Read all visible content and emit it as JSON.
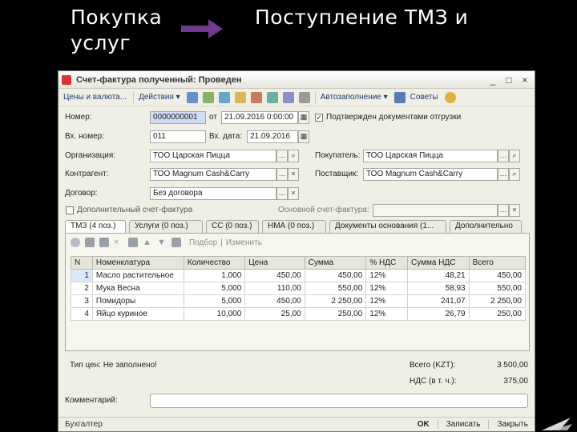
{
  "slide": {
    "left_title": "Покупка услуг",
    "right_title": "Поступление ТМЗ и"
  },
  "window": {
    "title": "Счет-фактура полученный: Проведен",
    "controls": [
      "_",
      "□",
      "×"
    ]
  },
  "toolbar": {
    "prices_btn": "Цены и валюта...",
    "actions_btn": "Действия ▾",
    "autofill_btn": "Автозаполнение ▾",
    "tips_btn": "Советы"
  },
  "form": {
    "number_label": "Номер:",
    "number_value": "0000000001",
    "date_from_label": "от",
    "date_from_value": "21.09.2016 0:00:00",
    "confirmed_label": "Подтвержден документами отгрузки",
    "in_number_label": "Вх. номер:",
    "in_number_value": "011",
    "in_date_label": "Вх. дата:",
    "in_date_value": "21.09.2016",
    "org_label": "Организация:",
    "org_value": "ТОО Царская Пицца",
    "buyer_label": "Покупатель:",
    "buyer_value": "ТОО Царская Пицца",
    "counterparty_label": "Контрагент:",
    "counterparty_value": "ТОО Magnum Cash&Carry",
    "supplier_label": "Поставщик:",
    "supplier_value": "ТОО Magnum Cash&Carry",
    "contract_label": "Договор:",
    "contract_value": "Без договора",
    "extra_invoice_label": "Дополнительный счет-фактура",
    "base_invoice_label": "Основной счет-фактура:"
  },
  "tabs": [
    {
      "label": "ТМЗ (4 поз.)"
    },
    {
      "label": "Услуги (0 поз.)"
    },
    {
      "label": "СС (0 поз.)"
    },
    {
      "label": "НМА (0 поз.)"
    },
    {
      "label": "Документы основания (1..."
    },
    {
      "label": "Дополнительно"
    }
  ],
  "panel_toolbar": {
    "pick_label": "Подбор",
    "change_label": "Изменить"
  },
  "table": {
    "headers": [
      "N",
      "Номенклатура",
      "Количество",
      "Цена",
      "Сумма",
      "% НДС",
      "Сумма НДС",
      "Всего"
    ],
    "rows": [
      [
        "1",
        "Масло растительное",
        "1,000",
        "450,00",
        "450,00",
        "12%",
        "48,21",
        "450,00"
      ],
      [
        "2",
        "Мука Весна",
        "5,000",
        "110,00",
        "550,00",
        "12%",
        "58,93",
        "550,00"
      ],
      [
        "3",
        "Помидоры",
        "5,000",
        "450,00",
        "2 250,00",
        "12%",
        "241,07",
        "2 250,00"
      ],
      [
        "4",
        "Яйцо куриное",
        "10,000",
        "25,00",
        "250,00",
        "12%",
        "26,79",
        "250,00"
      ]
    ]
  },
  "footer": {
    "price_type": "Тип цен: Не заполнено!",
    "total_label": "Всего (KZT):",
    "total_value": "3 500,00",
    "vat_label": "НДС (в т. ч.):",
    "vat_value": "375,00",
    "comment_label": "Комментарий:"
  },
  "statusbar": {
    "user": "Бухгалтер",
    "ok": "OK",
    "save": "Записать",
    "close": "Закрыть"
  },
  "colors": {
    "arrow": "#6f3a8f",
    "link": "#1f3a72",
    "selection": "#dbe7fb"
  }
}
